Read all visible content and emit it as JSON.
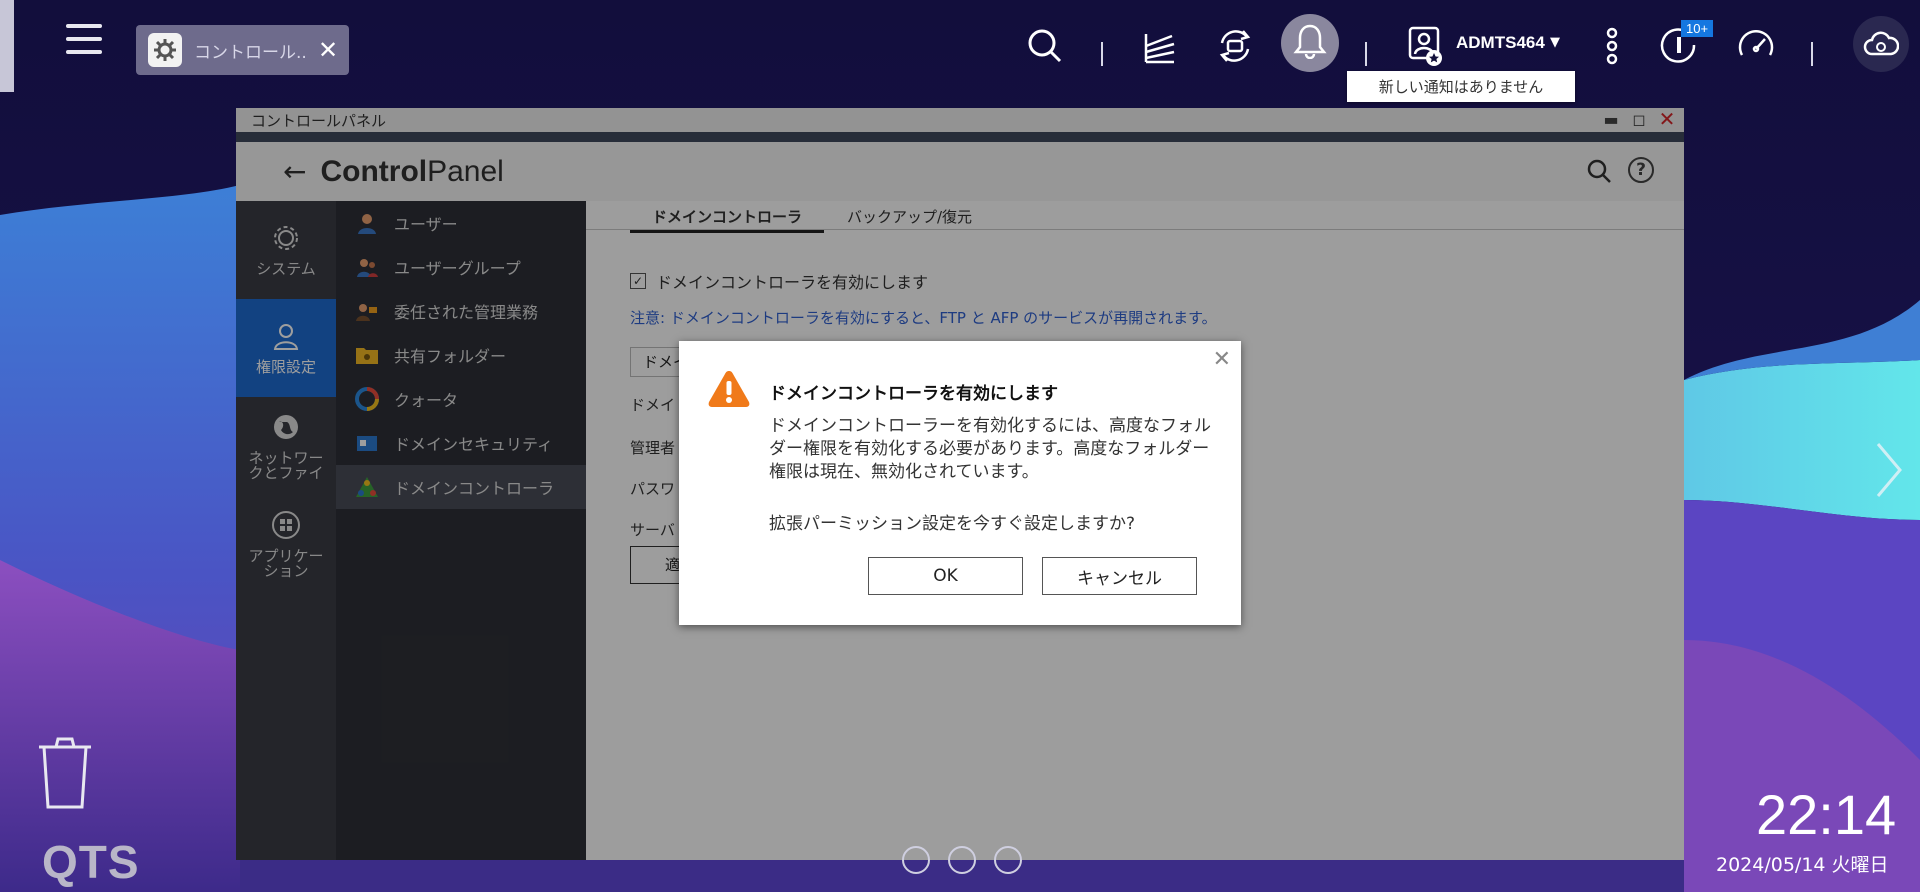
{
  "taskbar": {
    "open_app_label": "コントロール...",
    "close_symbol": "✕",
    "user_name": "ADMTS464",
    "notification_badge": "10+",
    "notification_tooltip": "新しい通知はありません"
  },
  "window": {
    "title": "コントロールパネル",
    "app_title_bold": "Control",
    "app_title_light": "Panel",
    "categories": [
      {
        "label": "システム",
        "icon": "gear-icon"
      },
      {
        "label": "権限設定",
        "icon": "user-icon",
        "active": true
      },
      {
        "label": "ネットワー\nクとファイ",
        "icon": "globe-icon"
      },
      {
        "label": "アプリケー\nション",
        "icon": "apps-grid-icon"
      }
    ],
    "menu": [
      {
        "label": "ユーザー"
      },
      {
        "label": "ユーザーグループ"
      },
      {
        "label": "委任された管理業務"
      },
      {
        "label": "共有フォルダー"
      },
      {
        "label": "クォータ"
      },
      {
        "label": "ドメインセキュリティ"
      },
      {
        "label": "ドメインコントローラ",
        "active": true
      }
    ],
    "tabs": [
      "ドメインコントローラ",
      "バックアップ/復元"
    ],
    "enable_checkbox_label": "ドメインコントローラを有効にします",
    "note": "注意: ドメインコントローラを有効にすると、FTP と AFP のサービスが再開されます。",
    "select_fragment": "ドメイ",
    "field_fragments": [
      "ドメイ",
      "管理者",
      "パスワ",
      "サーバ"
    ],
    "button_fragment": "適"
  },
  "dialog": {
    "title": "ドメインコントローラを有効にします",
    "message": "ドメインコントローラーを有効化するには、高度なフォルダー権限を有効化する必要があります。高度なフォルダー権限は現在、無効化されています。",
    "question": "拡張パーミッション設定を今すぐ設定しますか?",
    "ok": "OK",
    "cancel": "キャンセル"
  },
  "desktop": {
    "brand": "QTS",
    "time": "22:14",
    "date": "2024/05/14 火曜日"
  },
  "colors": {
    "accent": "#1e6bd0",
    "warning": "#f07a1a",
    "note_text": "#2f5fd0"
  }
}
